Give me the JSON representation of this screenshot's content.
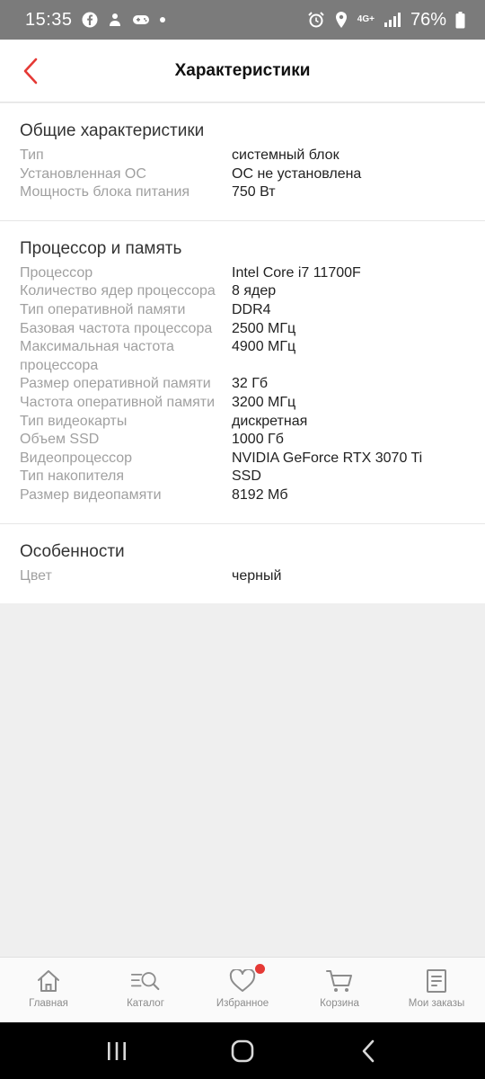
{
  "status_bar": {
    "time": "15:35",
    "network": "4G+",
    "battery": "76%"
  },
  "header": {
    "title": "Характеристики"
  },
  "sections": [
    {
      "title": "Общие характеристики",
      "rows": [
        {
          "label": "Тип",
          "value": "системный блок"
        },
        {
          "label": "Установленная ОС",
          "value": "ОС не установлена"
        },
        {
          "label": "Мощность блока питания",
          "value": "750 Вт"
        }
      ]
    },
    {
      "title": "Процессор и память",
      "rows": [
        {
          "label": "Процессор",
          "value": "Intel Core i7 11700F"
        },
        {
          "label": "Количество ядер процессора",
          "value": "8 ядер"
        },
        {
          "label": "Тип оперативной памяти",
          "value": "DDR4"
        },
        {
          "label": "Базовая частота процессора",
          "value": "2500 МГц"
        },
        {
          "label": "Максимальная частота процессора",
          "value": "4900 МГц"
        },
        {
          "label": "Размер оперативной памяти",
          "value": "32 Гб"
        },
        {
          "label": "Частота оперативной памяти",
          "value": "3200 МГц"
        },
        {
          "label": "Тип видеокарты",
          "value": "дискретная"
        },
        {
          "label": "Объем SSD",
          "value": "1000 Гб"
        },
        {
          "label": "Видеопроцессор",
          "value": "NVIDIA GeForce RTX 3070 Ti"
        },
        {
          "label": "Тип накопителя",
          "value": "SSD"
        },
        {
          "label": "Размер видеопамяти",
          "value": "8192 Мб"
        }
      ]
    },
    {
      "title": "Особенности",
      "rows": [
        {
          "label": "Цвет",
          "value": "черный"
        }
      ]
    }
  ],
  "bottom_nav": [
    {
      "label": "Главная",
      "icon": "home-icon"
    },
    {
      "label": "Каталог",
      "icon": "catalog-search-icon"
    },
    {
      "label": "Избранное",
      "icon": "heart-icon",
      "badge": true
    },
    {
      "label": "Корзина",
      "icon": "cart-icon"
    },
    {
      "label": "Мои заказы",
      "icon": "orders-icon"
    }
  ],
  "colors": {
    "accent": "#e53935",
    "status_bar": "#7b7b7b",
    "label_gray": "#a0a0a0"
  }
}
